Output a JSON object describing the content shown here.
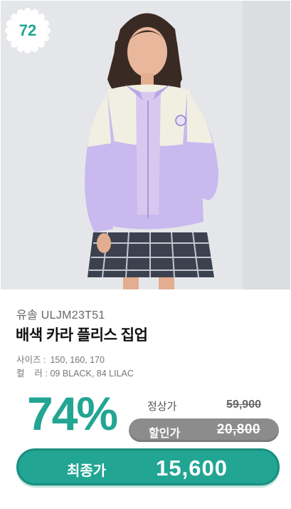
{
  "rank_badge": {
    "number": "72",
    "color": "#22a593"
  },
  "product": {
    "brand_code": "유솔 ULJM23T51",
    "title": "배색 카라 플리스 집업",
    "size_key": "사이즈 :",
    "size_value": "150, 160, 170",
    "color_key": "컬    러 :",
    "color_value": "09 BLACK, 84 LILAC"
  },
  "pricing": {
    "discount_rate": "74%",
    "regular_label": "정상가",
    "regular_price": "59,900",
    "sale_label": "할인가",
    "sale_price": "20,800",
    "final_label": "최종가",
    "final_price": "15,600"
  },
  "colors": {
    "accent": "#22a593",
    "sale_pill": "#8c8c8c"
  },
  "image": {
    "icon": "product-photo"
  }
}
